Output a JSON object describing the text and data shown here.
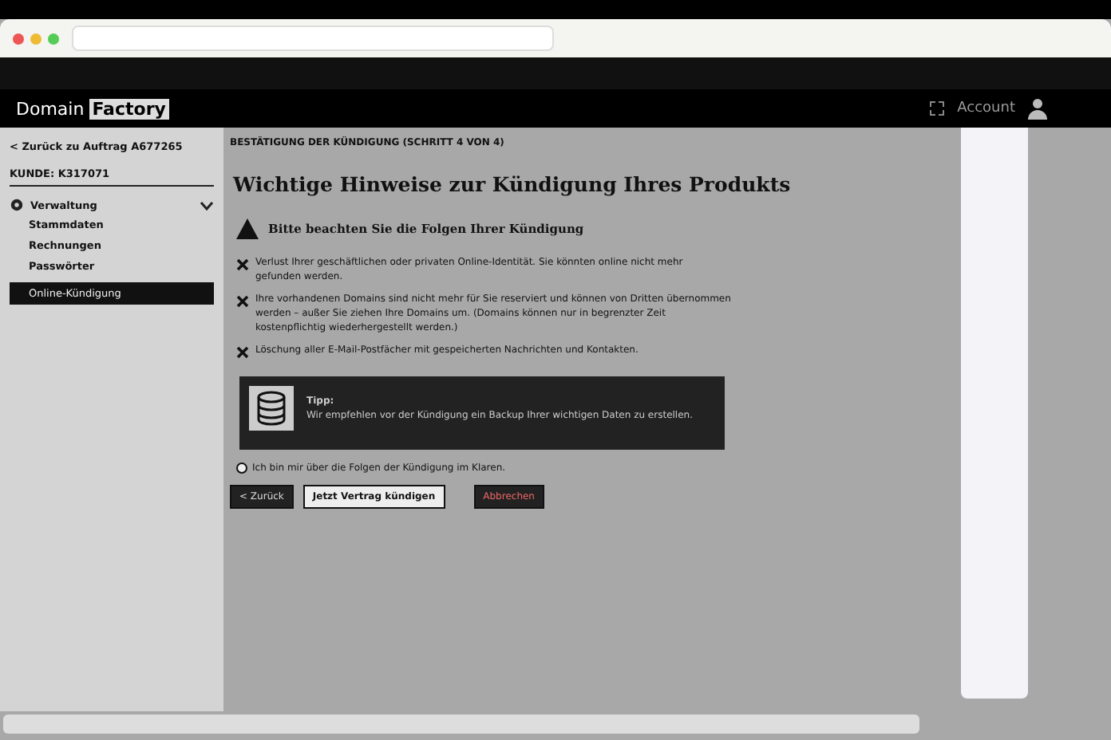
{
  "header": {
    "logo": [
      "Domain",
      "Factory"
    ],
    "account": "Account"
  },
  "sidebar": {
    "back_link": "< Zurück zu Auftrag A677265",
    "customer": "KUNDE: K317071",
    "section": {
      "label": "Verwaltung",
      "expanded": true,
      "children": [
        {
          "label": "Stammdaten",
          "selected": false
        },
        {
          "label": "Rechnungen",
          "selected": false
        },
        {
          "label": "Passwörter",
          "selected": false
        },
        {
          "label": "Online-Kündigung",
          "selected": true
        }
      ]
    }
  },
  "main": {
    "step": "BESTÄTIGUNG DER KÜNDIGUNG (SCHRITT 4 VON 4)",
    "title": "Wichtige Hinweise zur Kündigung Ihres Produkts",
    "warning": "Bitte beachten Sie die Folgen Ihrer Kündigung",
    "consequences": [
      "Verlust Ihrer geschäftlichen oder privaten Online-Identität. Sie könnten online nicht mehr gefunden werden.",
      "Ihre vorhandenen Domains sind nicht mehr für Sie reserviert und können von Dritten übernommen werden – außer Sie ziehen Ihre Domains um. (Domains können nur in begrenzter Zeit kostenpflichtig wiederhergestellt werden.)",
      "Löschung aller E-Mail-Postfächer mit gespeicherten Nachrichten und Kontakten."
    ],
    "tip": {
      "label": "Tipp:",
      "text": "Wir empfehlen vor der Kündigung ein Backup Ihrer wichtigen Daten zu erstellen."
    },
    "confirm": {
      "label": "Ich bin mir über die Folgen der Kündigung im Klaren.",
      "checked": false
    },
    "buttons": [
      {
        "label": "< Zurück",
        "kind": "back"
      },
      {
        "label": "Jetzt Vertrag kündigen",
        "kind": "primary"
      },
      {
        "label": "Abbrechen",
        "kind": "cancel"
      }
    ]
  }
}
